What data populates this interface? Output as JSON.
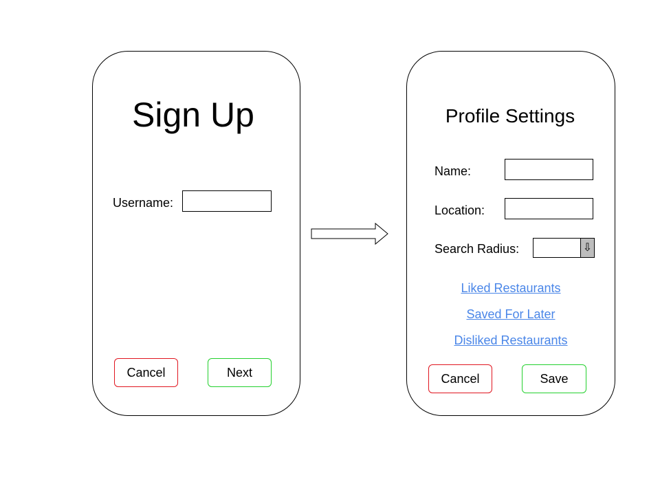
{
  "colors": {
    "cancel_border": "#e0141e",
    "confirm_border": "#22d02c",
    "link": "#4a86e8",
    "dropdown_arrow_bg": "#bdbdbd"
  },
  "signup": {
    "title": "Sign Up",
    "username_label": "Username:",
    "username_value": "",
    "cancel_label": "Cancel",
    "next_label": "Next"
  },
  "flow_arrow": {
    "icon": "right-arrow-icon"
  },
  "profile": {
    "title": "Profile Settings",
    "name_label": "Name:",
    "name_value": "",
    "location_label": "Location:",
    "location_value": "",
    "radius_label": "Search Radius:",
    "radius_value": "",
    "radius_arrow_icon": "down-arrow-icon",
    "radius_arrow_glyph": "⇩",
    "links": {
      "liked": "Liked Restaurants",
      "saved": "Saved For Later",
      "disliked": "Disliked Restaurants"
    },
    "cancel_label": "Cancel",
    "save_label": "Save"
  }
}
